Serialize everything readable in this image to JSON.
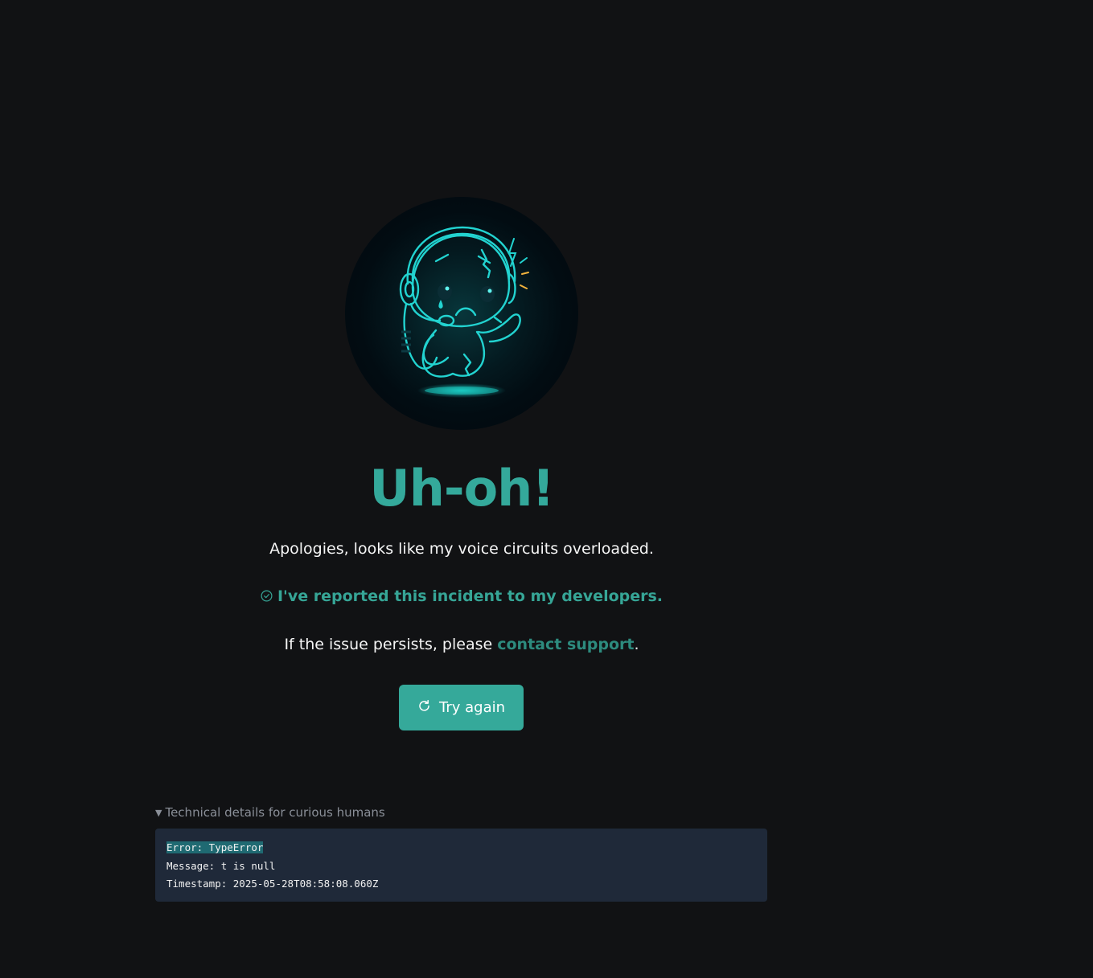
{
  "error_page": {
    "title": "Uh-oh!",
    "apology": "Apologies, looks like my voice circuits overloaded.",
    "reported": "I've reported this incident to my developers.",
    "persists_prefix": "If the issue persists, please ",
    "contact_link": "contact support",
    "persists_suffix": ".",
    "retry_label": "Try again"
  },
  "details": {
    "summary": "Technical details for curious humans",
    "error_line": "Error: TypeError",
    "message_line": "Message: t is null",
    "timestamp_line": "Timestamp: 2025-05-28T08:58:08.060Z"
  },
  "colors": {
    "accent": "#34a99b",
    "background": "#111214",
    "code_background": "#1f2939",
    "link": "#2d8b7e"
  },
  "icons": {
    "illustration": "sad-robot-headset-illustration",
    "check": "check-circle-icon",
    "retry": "refresh-icon",
    "disclosure": "triangle-down-icon"
  }
}
